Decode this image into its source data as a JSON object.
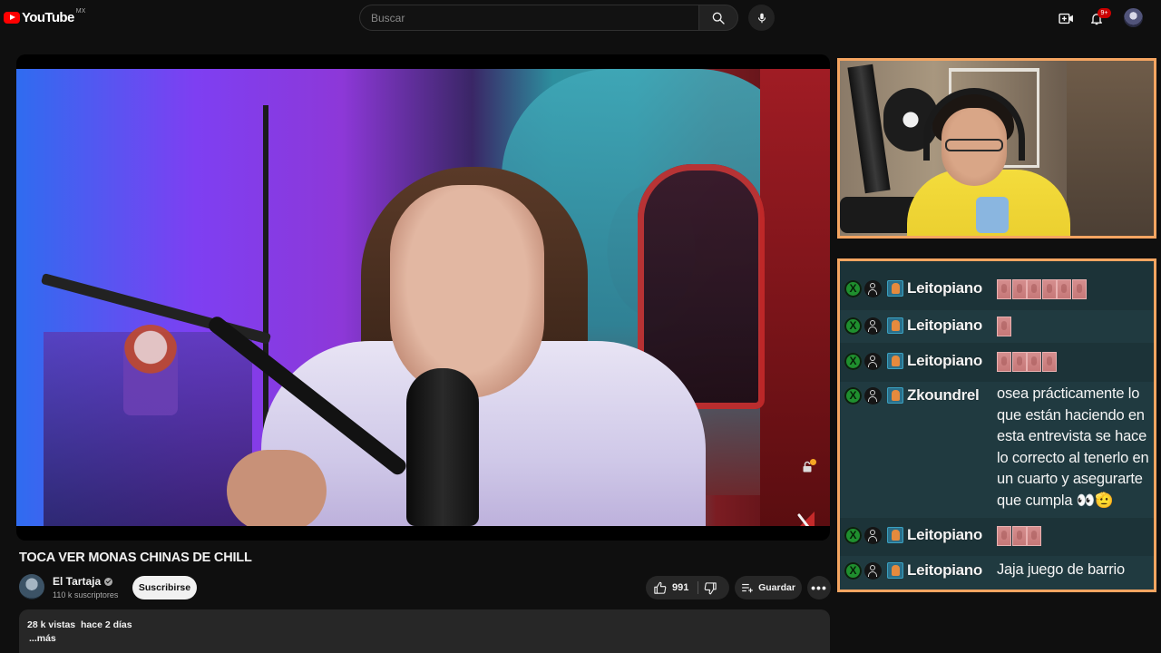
{
  "topbar": {
    "logo_text": "YouTube",
    "logo_region": "MX",
    "search_placeholder": "Buscar",
    "notification_count": "9+",
    "icons": [
      "search-icon",
      "mic-icon",
      "create-icon",
      "bell-icon",
      "avatar"
    ]
  },
  "video": {
    "title": "TOCA VER MONAS CHINAS DE CHILL",
    "channel": "El Tartaja",
    "subscribers": "110 k suscriptores",
    "subscribe_label": "Suscribirse",
    "likes": "991",
    "save_label": "Guardar",
    "more_label": "•••",
    "views": "28 k vistas",
    "date": "hace 2 días",
    "show_more": "...más"
  },
  "chat": {
    "messages": [
      {
        "user": "Leitopiano",
        "emotes": 6
      },
      {
        "user": "Leitopiano",
        "emotes": 1
      },
      {
        "user": "Leitopiano",
        "emotes": 4
      },
      {
        "user": "Zkoundrel",
        "text": "osea prácticamente lo que están haciendo en esta entrevista se hace lo correcto al tenerlo en un cuarto y asegurarte que cumpla 👀🫡"
      },
      {
        "user": "Leitopiano",
        "emotes": 3
      },
      {
        "user": "Leitopiano",
        "text": "Jaja juego de barrio"
      }
    ]
  },
  "colors": {
    "background": "#0f0f0f",
    "overlay_border": "#f5a561",
    "chat_background": "#1c3338",
    "brand_red": "#ff0000"
  }
}
